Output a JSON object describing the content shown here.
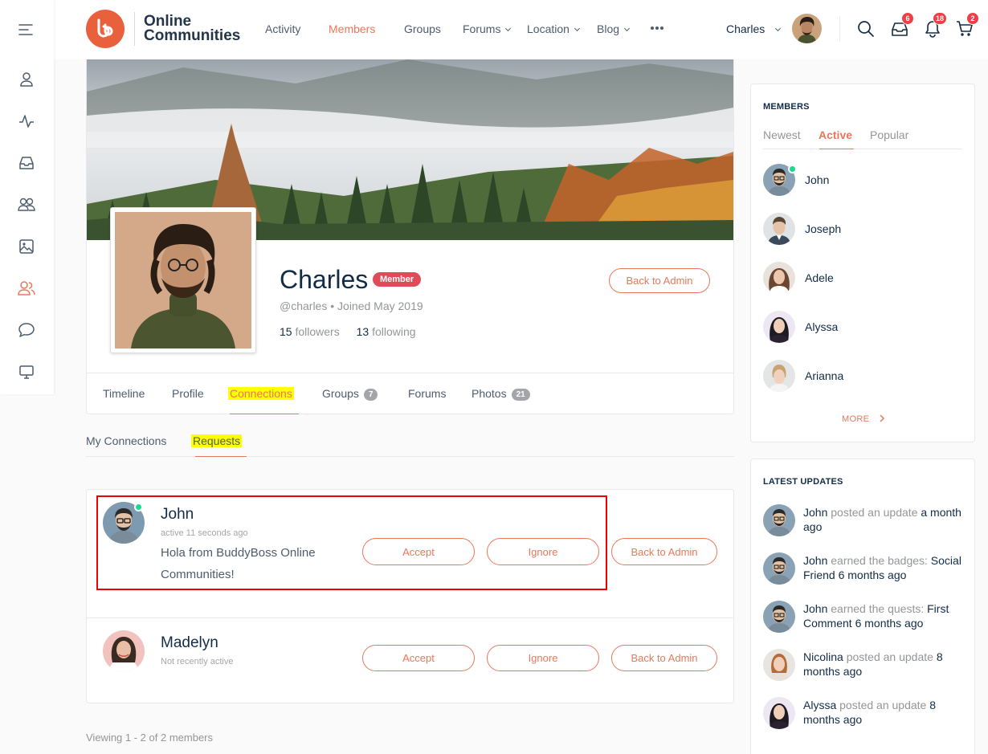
{
  "sidebar": {
    "icons": [
      "menu-icon",
      "user-icon",
      "activity-icon",
      "inbox-icon",
      "groups-icon",
      "photos-icon",
      "members-icon",
      "forums-icon",
      "monitor-icon"
    ]
  },
  "header": {
    "logo_text": "Online Communities",
    "nav": [
      "Activity",
      "Members",
      "Groups",
      "Forums",
      "Location",
      "Blog"
    ],
    "user_name": "Charles",
    "badges": {
      "messages": "6",
      "notifications": "18",
      "cart": "2"
    }
  },
  "profile": {
    "name": "Charles",
    "role_badge": "Member",
    "handle": "@charles",
    "joined": "Joined May 2019",
    "followers_count": "15",
    "followers_label": "followers",
    "following_count": "13",
    "following_label": "following",
    "back_button": "Back to Admin",
    "tabs": [
      {
        "label": "Timeline",
        "count": ""
      },
      {
        "label": "Profile",
        "count": ""
      },
      {
        "label": "Connections",
        "count": ""
      },
      {
        "label": "Groups",
        "count": "7"
      },
      {
        "label": "Forums",
        "count": ""
      },
      {
        "label": "Photos",
        "count": "21"
      }
    ]
  },
  "subtabs": [
    "My Connections",
    "Requests"
  ],
  "requests": [
    {
      "name": "John",
      "status": "active 11 seconds ago",
      "message": "Hola from BuddyBoss Online Communities!",
      "accept": "Accept",
      "ignore": "Ignore",
      "back": "Back to Admin"
    },
    {
      "name": "Madelyn",
      "status": "Not recently active",
      "message": "",
      "accept": "Accept",
      "ignore": "Ignore",
      "back": "Back to Admin"
    }
  ],
  "viewing": "Viewing 1 - 2 of 2 members",
  "members_widget": {
    "title": "MEMBERS",
    "tabs": [
      "Newest",
      "Active",
      "Popular"
    ],
    "members": [
      "John",
      "Joseph",
      "Adele",
      "Alyssa",
      "Arianna"
    ],
    "more": "MORE"
  },
  "updates_widget": {
    "title": "LATEST UPDATES",
    "items": [
      {
        "actor": "John",
        "action": "posted an update",
        "obj": "a month ago"
      },
      {
        "actor": "John",
        "action": "earned the badges:",
        "obj": "Social Friend 6 months ago"
      },
      {
        "actor": "John",
        "action": "earned the quests:",
        "obj": "First Comment 6 months ago"
      },
      {
        "actor": "Nicolina",
        "action": "posted an update",
        "obj": "8 months ago"
      },
      {
        "actor": "Alyssa",
        "action": "posted an update",
        "obj": "8 months ago"
      }
    ]
  },
  "colors": {
    "accent": "#e8785b",
    "brand": "#e8603c",
    "badge_red": "#ef3e46",
    "online": "#1cd991",
    "member_badge": "#e04b5a"
  }
}
